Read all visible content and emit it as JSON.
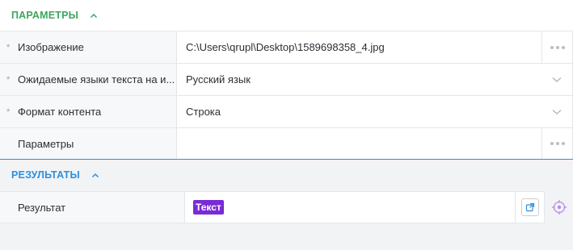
{
  "params_section": {
    "title": "Параметры"
  },
  "rows": [
    {
      "required": "*",
      "label": "Изображение",
      "value": "C:\\Users\\qrupl\\Desktop\\1589698358_4.jpg",
      "control": "dots"
    },
    {
      "required": "*",
      "label": "Ожидаемые языки текста на и...",
      "value": "Русский язык",
      "control": "dropdown"
    },
    {
      "required": "*",
      "label": "Формат контента",
      "value": "Строка",
      "control": "dropdown"
    },
    {
      "required": "",
      "label": "Параметры",
      "value": "",
      "control": "dots"
    }
  ],
  "results_section": {
    "title": "Результаты"
  },
  "result": {
    "label": "Результат",
    "tag": "Текст"
  },
  "colors": {
    "params_accent": "#3ca65c",
    "results_accent": "#2d8fdd",
    "tag_bg": "#7a2ad6"
  },
  "icons": {
    "collapse": "chevron-up-icon",
    "more": "dots-icon",
    "dropdown": "chevron-down-icon",
    "open": "open-external-icon",
    "target": "crosshair-icon"
  }
}
